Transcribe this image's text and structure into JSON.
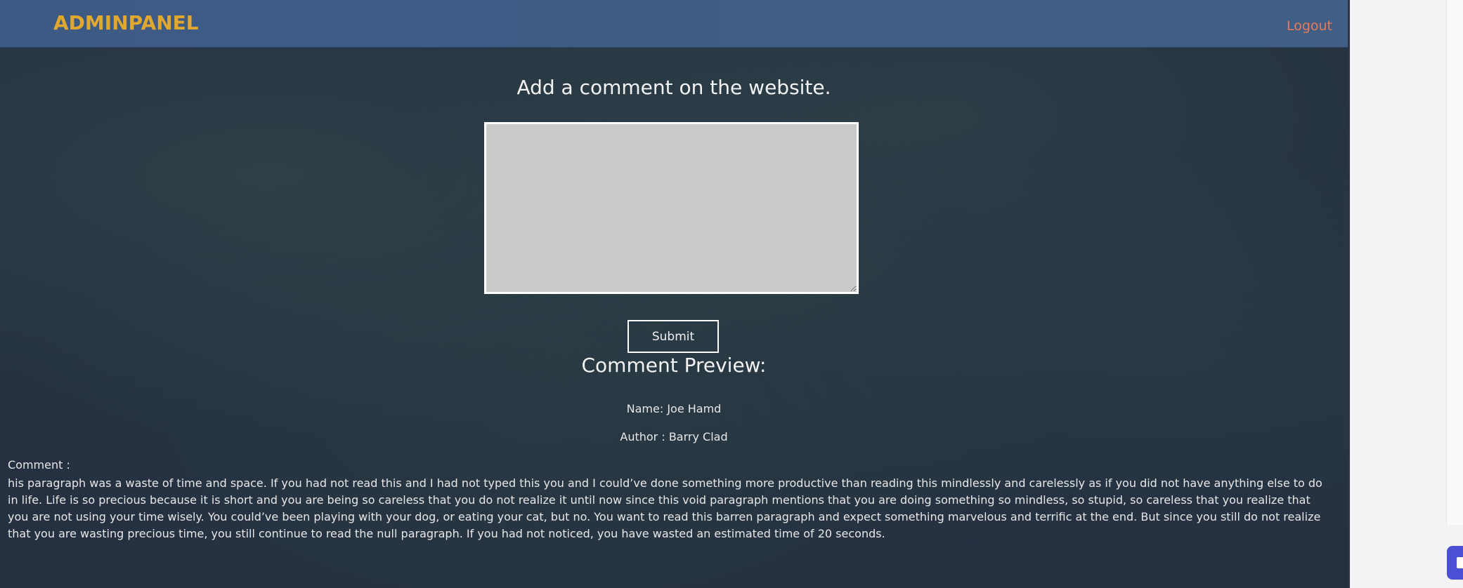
{
  "header": {
    "brand": "ADMINPANEL",
    "logout_label": "Logout"
  },
  "form": {
    "heading": "Add a comment on the website.",
    "comment_value": "",
    "submit_label": "Submit"
  },
  "preview": {
    "title": "Comment Preview:",
    "name_line": "Name: Joe Hamd",
    "author_line": "Author : Barry Clad",
    "comment_label": "Comment :",
    "comment_text": "his paragraph was a waste of time and space. If you had not read this and I had not typed this you and I could’ve done something more productive than reading this mindlessly and carelessly as if you did not have anything else to do in life. Life is so precious because it is short and you are being so careless that you do not realize it until now since this void paragraph mentions that you are doing something so mindless, so stupid, so careless that you realize that you are not using your time wisely. You could’ve been playing with your dog, or eating your cat, but no. You want to read this barren paragraph and expect something marvelous and terrific at the end. But since you still do not realize that you are wasting precious time, you still continue to read the null paragraph. If you had not noticed, you have wasted an estimated time of 20 seconds."
  },
  "colors": {
    "brand": "#e0a82e",
    "logout": "#e87b5a",
    "topbar": "#3d5a85",
    "background": "#253041",
    "textarea": "#c9caca"
  },
  "icons": {
    "side_widget": "chat-widget-icon"
  }
}
